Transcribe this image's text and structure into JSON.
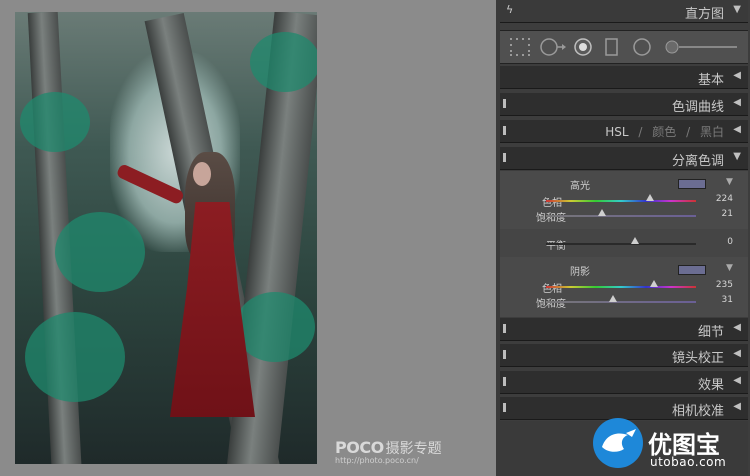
{
  "panels": {
    "histogram": "直方图",
    "basic": "基本",
    "tone_curve": "色调曲线",
    "hsl": "HSL",
    "color": "颜色",
    "bw": "黑白",
    "split_toning": "分离色调",
    "detail": "细节",
    "lens_correction": "镜头校正",
    "effects": "效果",
    "camera_calibration": "相机校准",
    "slash": "/"
  },
  "split": {
    "highlights_label": "高光",
    "hue_label": "色相",
    "saturation_label": "饱和度",
    "balance_label": "平衡",
    "shadows_label": "阴影",
    "highlights_hue": "224",
    "highlights_saturation": "21",
    "balance": "0",
    "shadows_hue": "235",
    "shadows_saturation": "31",
    "highlights_color": "#6b6d92",
    "shadows_color": "#6b6d92"
  },
  "watermark": {
    "brand": "POCO",
    "sub": "摄影专题",
    "url": "http://photo.poco.cn/"
  },
  "logo": {
    "text": "优图宝",
    "url": "utobao.com"
  },
  "icons": [
    "lightning-icon",
    "grid-tool-icon",
    "crop-circle-tool-icon",
    "spot-removal-icon",
    "graduated-filter-icon",
    "radial-filter-icon",
    "brush-slider-icon"
  ]
}
